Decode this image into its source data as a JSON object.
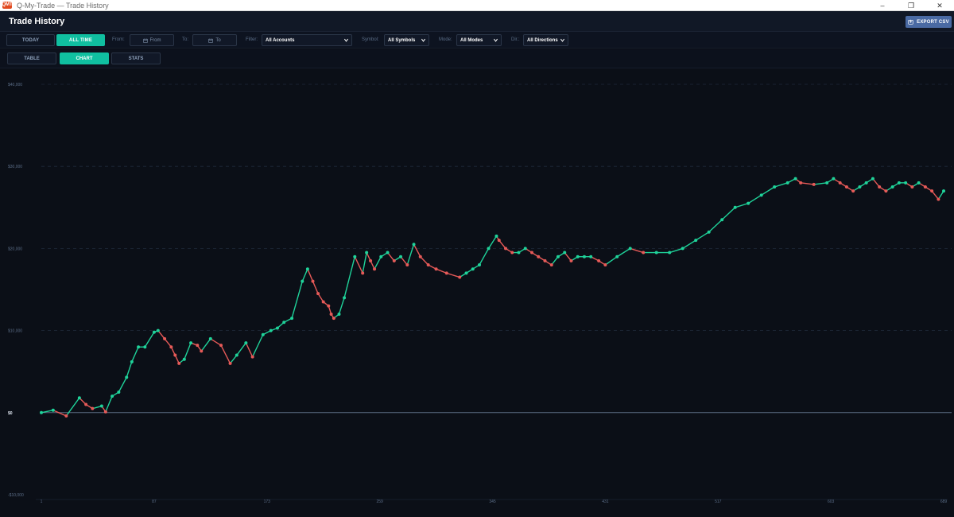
{
  "window": {
    "title": "Q-My-Trade — Trade History",
    "logo_text": "QMT",
    "controls": [
      "–",
      "❐",
      "✕"
    ]
  },
  "header": {
    "title": "Trade History",
    "export_label": "EXPORT CSV"
  },
  "filters": {
    "period_today": "TODAY",
    "period_all": "ALL TIME",
    "from_label": "From:",
    "from_placeholder": "From",
    "to_label": "To:",
    "to_placeholder": "To",
    "filter_label": "Filter:",
    "filter_value": "All Accounts",
    "symbol_label": "Symbol:",
    "symbol_value": "All Symbols",
    "mode_label": "Mode:",
    "mode_value": "All Modes",
    "dir_label": "Dir.:",
    "dir_value": "All Directions"
  },
  "tabs": [
    {
      "label": "TABLE",
      "active": false
    },
    {
      "label": "CHART",
      "active": true
    },
    {
      "label": "STATS",
      "active": false
    }
  ],
  "colors": {
    "accent": "#10bfa0",
    "gain": "#1fd39a",
    "loss": "#e65a58",
    "export": "#4a6aa3"
  },
  "chart_data": {
    "type": "line",
    "title": "",
    "xlabel": "",
    "ylabel": "",
    "ylim": [
      -10000,
      40000
    ],
    "xlim": [
      1,
      689
    ],
    "yticks": [
      {
        "value": 40000,
        "label": "$40,000"
      },
      {
        "value": 30000,
        "label": "$30,000"
      },
      {
        "value": 20000,
        "label": "$20,000"
      },
      {
        "value": 10000,
        "label": "$10,000"
      },
      {
        "value": 0,
        "label": "$0"
      },
      {
        "value": -10000,
        "label": "-$10,000"
      }
    ],
    "xticks": [
      {
        "value": 1,
        "label": "1"
      },
      {
        "value": 87,
        "label": "87"
      },
      {
        "value": 173,
        "label": "173"
      },
      {
        "value": 259,
        "label": "259"
      },
      {
        "value": 345,
        "label": "345"
      },
      {
        "value": 431,
        "label": "431"
      },
      {
        "value": 517,
        "label": "517"
      },
      {
        "value": 603,
        "label": "603"
      },
      {
        "value": 689,
        "label": "689"
      }
    ],
    "grid": true,
    "series": [
      {
        "x": [
          1,
          10,
          20,
          30,
          35,
          40,
          47,
          50,
          55,
          60,
          66,
          70,
          75,
          80,
          87,
          90,
          95,
          100,
          103,
          106,
          110,
          115,
          120,
          123,
          130,
          138,
          145,
          150,
          157,
          162,
          170,
          176,
          181,
          186,
          192,
          200,
          204,
          208,
          212,
          216,
          220,
          222,
          224,
          228,
          232,
          240,
          246,
          249,
          252,
          255,
          260,
          265,
          270,
          275,
          280,
          285,
          290,
          296,
          302,
          310,
          320,
          325,
          330,
          335,
          342,
          348,
          350,
          355,
          360,
          365,
          370,
          375,
          380,
          385,
          390,
          395,
          400,
          405,
          410,
          415,
          420,
          426,
          431,
          440,
          450,
          460,
          470,
          480,
          490,
          500,
          510,
          520,
          530,
          540,
          550,
          560,
          570,
          576,
          580,
          590,
          600,
          605,
          610,
          615,
          620,
          625,
          630,
          635,
          640,
          645,
          650,
          655,
          660,
          665,
          670,
          675,
          680,
          685,
          689
        ],
        "y": [
          0,
          300,
          -400,
          1800,
          1000,
          500,
          800,
          100,
          2000,
          2500,
          4300,
          6200,
          8000,
          8000,
          9800,
          10000,
          9000,
          8000,
          7000,
          6000,
          6500,
          8500,
          8200,
          7500,
          9000,
          8200,
          6000,
          7000,
          8500,
          6800,
          9500,
          10000,
          10300,
          11000,
          11500,
          16000,
          17500,
          16000,
          14500,
          13500,
          13000,
          12000,
          11500,
          12000,
          14000,
          19000,
          17000,
          19500,
          18500,
          17500,
          19000,
          19500,
          18500,
          19000,
          18000,
          20500,
          19000,
          18000,
          17500,
          17000,
          16500,
          17000,
          17500,
          18000,
          20000,
          21500,
          21000,
          20000,
          19500,
          19500,
          20000,
          19500,
          19000,
          18500,
          18000,
          19000,
          19500,
          18500,
          19000,
          19000,
          19000,
          18500,
          18000,
          19000,
          20000,
          19500,
          19500,
          19500,
          20000,
          21000,
          22000,
          23500,
          25000,
          25500,
          26500,
          27500,
          28000,
          28500,
          28000,
          27800,
          28000,
          28500,
          28000,
          27500,
          27000,
          27500,
          28000,
          28500,
          27500,
          27000,
          27500,
          28000,
          28000,
          27500,
          28000,
          27500,
          27000,
          26000,
          27000
        ]
      }
    ]
  }
}
